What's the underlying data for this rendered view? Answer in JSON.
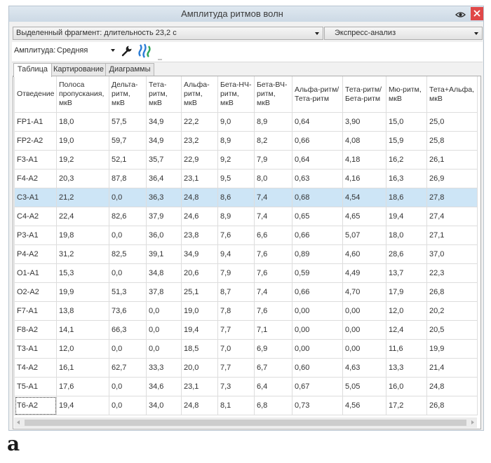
{
  "window": {
    "title": "Амплитуда ритмов волн",
    "eye_icon": "eye-icon",
    "close_icon": "close-icon"
  },
  "toolbar": {
    "fragment_select": {
      "value": "Выделенный фрагмент: длительность 23,2 с",
      "icon": "chevron-down-icon"
    },
    "analysis_select": {
      "value": "Экспресс-анализ",
      "icon": "chevron-down-icon"
    },
    "amplitude": {
      "label": "Амплитуда:",
      "value": "Средняя",
      "icon": "chevron-down-icon"
    },
    "tools": [
      "wrench-icon",
      "waves-icon",
      "small-tool-icon"
    ]
  },
  "tabs": [
    {
      "label": "Таблица",
      "active": true
    },
    {
      "label": "Картирование",
      "active": false
    },
    {
      "label": "Диаграммы",
      "active": false
    }
  ],
  "table": {
    "columns": [
      "Отведение",
      "Полоса\nпропускания,\nмкВ",
      "Дельта-\nритм,\nмкВ",
      "Тета-\nритм,\nмкВ",
      "Альфа-\nритм,\nмкВ",
      "Бета-НЧ-\nритм,\nмкВ",
      "Бета-ВЧ-\nритм,\nмкВ",
      "Альфа-ритм/\nТета-ритм",
      "Тета-ритм/\nБета-ритм",
      "Мю-ритм,\nмкВ",
      "Тета+Альфа,\nмкВ"
    ],
    "rows": [
      [
        "FP1-A1",
        "18,0",
        "57,5",
        "34,9",
        "22,2",
        "9,0",
        "8,9",
        "0,64",
        "3,90",
        "15,0",
        "25,0"
      ],
      [
        "FP2-A2",
        "19,0",
        "59,7",
        "34,9",
        "23,2",
        "8,9",
        "8,2",
        "0,66",
        "4,08",
        "15,9",
        "25,8"
      ],
      [
        "F3-A1",
        "19,2",
        "52,1",
        "35,7",
        "22,9",
        "9,2",
        "7,9",
        "0,64",
        "4,18",
        "16,2",
        "26,1"
      ],
      [
        "F4-A2",
        "20,3",
        "87,8",
        "36,4",
        "23,1",
        "9,5",
        "8,0",
        "0,63",
        "4,16",
        "16,3",
        "26,9"
      ],
      [
        "C3-A1",
        "21,2",
        "0,0",
        "36,3",
        "24,8",
        "8,6",
        "7,4",
        "0,68",
        "4,54",
        "18,6",
        "27,8"
      ],
      [
        "C4-A2",
        "22,4",
        "82,6",
        "37,9",
        "24,6",
        "8,9",
        "7,4",
        "0,65",
        "4,65",
        "19,4",
        "27,4"
      ],
      [
        "P3-A1",
        "19,8",
        "0,0",
        "36,0",
        "23,8",
        "7,6",
        "6,6",
        "0,66",
        "5,07",
        "18,0",
        "27,1"
      ],
      [
        "P4-A2",
        "31,2",
        "82,5",
        "39,1",
        "34,9",
        "9,4",
        "7,6",
        "0,89",
        "4,60",
        "28,6",
        "37,0"
      ],
      [
        "O1-A1",
        "15,3",
        "0,0",
        "34,8",
        "20,6",
        "7,9",
        "7,6",
        "0,59",
        "4,49",
        "13,7",
        "22,3"
      ],
      [
        "O2-A2",
        "19,9",
        "51,3",
        "37,8",
        "25,1",
        "8,7",
        "7,4",
        "0,66",
        "4,70",
        "17,9",
        "26,8"
      ],
      [
        "F7-A1",
        "13,8",
        "73,6",
        "0,0",
        "19,0",
        "7,8",
        "7,6",
        "0,00",
        "0,00",
        "12,0",
        "20,2"
      ],
      [
        "F8-A2",
        "14,1",
        "66,3",
        "0,0",
        "19,4",
        "7,7",
        "7,1",
        "0,00",
        "0,00",
        "12,4",
        "20,5"
      ],
      [
        "T3-A1",
        "12,0",
        "0,0",
        "0,0",
        "18,5",
        "7,0",
        "6,9",
        "0,00",
        "0,00",
        "11,6",
        "19,9"
      ],
      [
        "T4-A2",
        "16,1",
        "62,7",
        "33,3",
        "20,0",
        "7,7",
        "6,7",
        "0,60",
        "4,63",
        "13,3",
        "21,4"
      ],
      [
        "T5-A1",
        "17,6",
        "0,0",
        "34,6",
        "23,1",
        "7,3",
        "6,4",
        "0,67",
        "5,05",
        "16,0",
        "24,8"
      ],
      [
        "T6-A2",
        "19,4",
        "0,0",
        "34,0",
        "24,8",
        "8,1",
        "6,8",
        "0,73",
        "4,56",
        "17,2",
        "26,8"
      ]
    ],
    "selected_row": 4,
    "focused_cell": {
      "row": 15,
      "column": 0
    }
  },
  "figure_label": "а",
  "colors": {
    "title_bar": "#ccd9e5",
    "close_button": "#e04848",
    "selected_row": "#cde5f6",
    "grid": "#dddddd",
    "waves_blue": "#2b7dd6",
    "waves_green": "#2fa65a"
  }
}
